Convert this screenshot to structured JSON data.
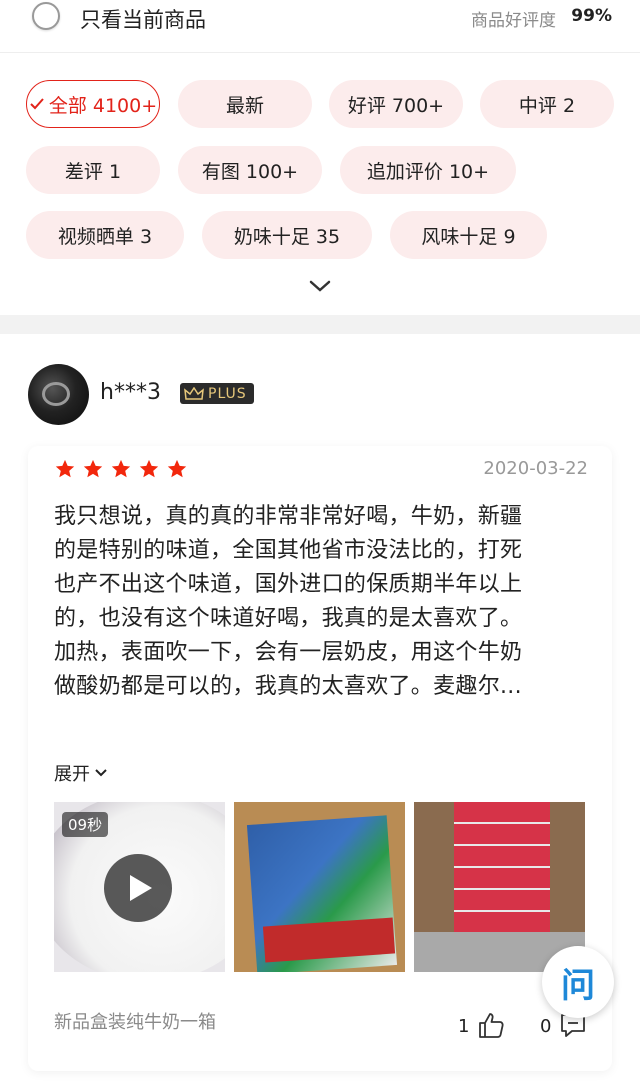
{
  "top_bar": {
    "only_current_label": "只看当前商品",
    "rating_label": "商品好评度",
    "rating_value": "99%"
  },
  "filters": [
    {
      "label": "全部 4100+",
      "active": true
    },
    {
      "label": "最新",
      "active": false
    },
    {
      "label": "好评 700+",
      "active": false
    },
    {
      "label": "中评 2",
      "active": false
    },
    {
      "label": "差评 1",
      "active": false
    },
    {
      "label": "有图 100+",
      "active": false
    },
    {
      "label": "追加评价 10+",
      "active": false
    },
    {
      "label": "视频晒单 3",
      "active": false
    },
    {
      "label": "奶味十足 35",
      "active": false
    },
    {
      "label": "风味十足 9",
      "active": false
    }
  ],
  "review": {
    "username": "h***3",
    "badge": "PLUS",
    "stars": 5,
    "date": "2020-03-22",
    "lines": [
      "我只想说，真的真的非常非常好喝，牛奶，新疆",
      "的是特别的味道，全国其他省市没法比的，打死",
      "也产不出这个味道，国外进口的保质期半年以上",
      "的，也没有这个味道好喝，我真的是太喜欢了。",
      "加热，表面吹一下，会有一层奶皮，用这个牛奶",
      "做酸奶都是可以的，我真的太喜欢了。麦趣尔..."
    ],
    "expand_label": "展开",
    "video_duration": "09秒",
    "product_variant": "新品盒装纯牛奶一箱",
    "likes": "1",
    "comments": "0"
  },
  "ask_button": "问",
  "colors": {
    "accent": "#e2231a",
    "chip_bg": "#fcecec",
    "star": "#f2270c",
    "ask": "#1e88d8"
  }
}
